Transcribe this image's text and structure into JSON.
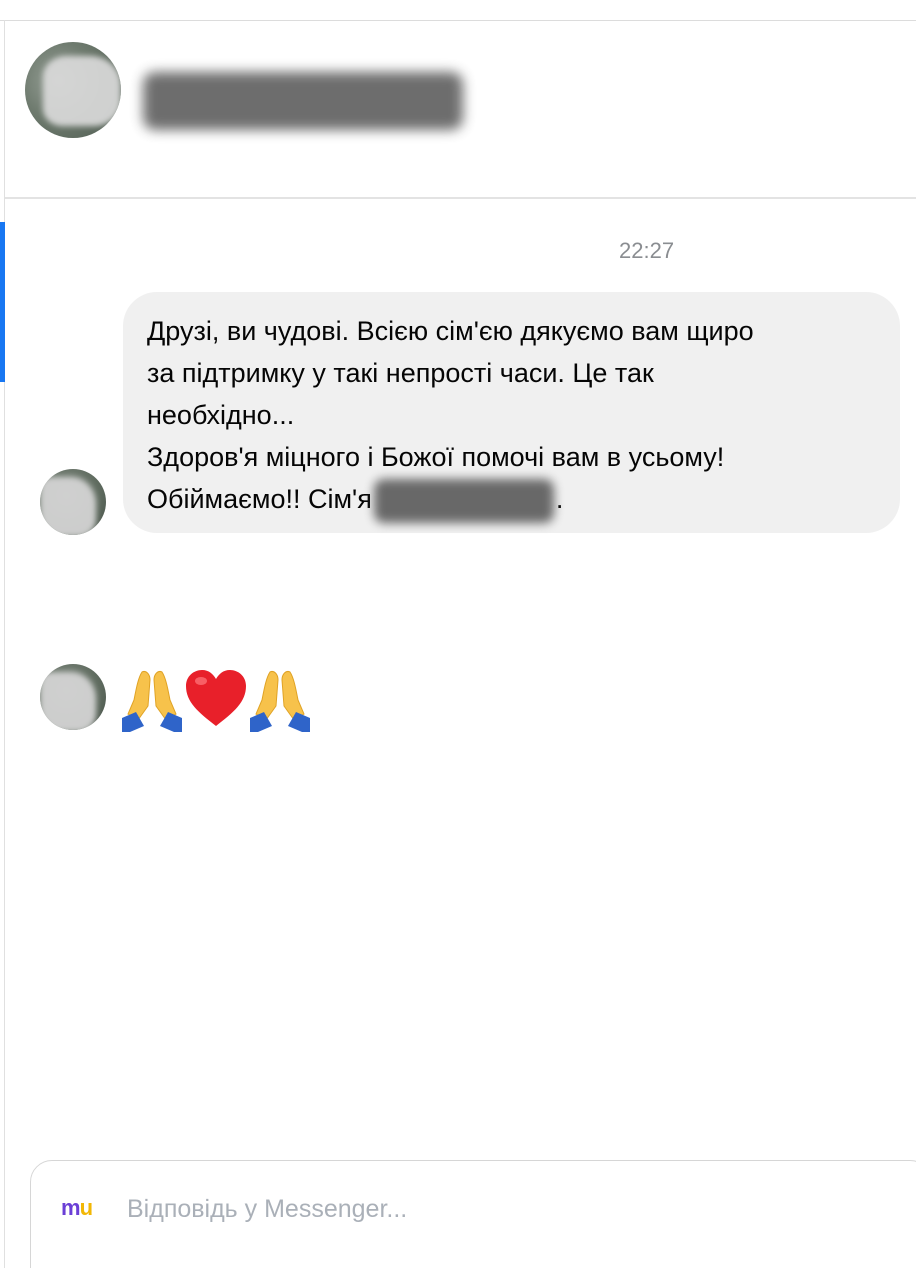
{
  "conversation": {
    "timestamp": "22:27",
    "message": {
      "lines": [
        "Друзі, ви чудові. Всією сім'єю дякуємо вам щиро",
        "за підтримку у такі непрості часи. Це так",
        "необхідно...",
        "Здоров'я міцного і Божої помочі вам в усьому!"
      ],
      "last_line_prefix": "Обіймаємо!! Сім'я",
      "last_line_suffix": "."
    },
    "emoji_message": {
      "emojis": [
        "folded-hands",
        "red-heart",
        "folded-hands"
      ]
    }
  },
  "composer": {
    "logo_m": "m",
    "logo_u": "u",
    "placeholder": "Відповідь у Messenger..."
  },
  "colors": {
    "accent": "#1877f2",
    "bubble_bg": "#f0f0f0",
    "logo_m": "#6b3fd6",
    "logo_u": "#f2b705"
  }
}
